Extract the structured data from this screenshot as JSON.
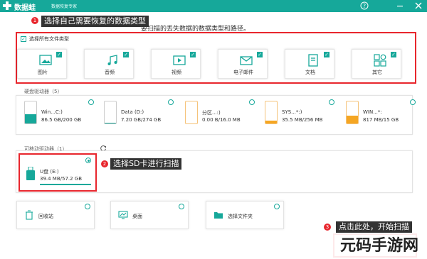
{
  "app": {
    "title": "数据蛙",
    "subtitle": "数据恢复专家",
    "window_controls": {
      "help": "?",
      "minimize": "—",
      "close": "✕"
    }
  },
  "steps": {
    "step1": {
      "num": "1",
      "text": "选择自己需要恢复的数据类型"
    },
    "step2": {
      "num": "2",
      "text": "选择SD卡进行扫描"
    },
    "step3": {
      "num": "3",
      "text": "点击此处，开始扫描"
    }
  },
  "hint": "要扫描的丢失数据的数据类型和路径。",
  "file_types": {
    "select_all_label": "选择所有文件类型",
    "select_all_checked": true,
    "items": [
      {
        "label": "图片",
        "icon": "image-icon",
        "checked": true
      },
      {
        "label": "音频",
        "icon": "audio-icon",
        "checked": true
      },
      {
        "label": "视频",
        "icon": "video-icon",
        "checked": true
      },
      {
        "label": "电子邮件",
        "icon": "email-icon",
        "checked": true
      },
      {
        "label": "文档",
        "icon": "document-icon",
        "checked": true
      },
      {
        "label": "其它",
        "icon": "other-icon",
        "checked": true
      }
    ]
  },
  "hard_drives": {
    "title": "硬盘驱动器（5）",
    "items": [
      {
        "name": "Win...C:)",
        "size": "86.5 GB/200 GB",
        "used": 0.43,
        "color": "#16a89a"
      },
      {
        "name": "Data (D:)",
        "size": "7.20 GB/274 GB",
        "used": 0.03,
        "color": "#16a89a"
      },
      {
        "name": "分区...:)",
        "size": "0.00 B/16.0 MB",
        "used": 0.0,
        "color": "#f5a623"
      },
      {
        "name": "SYS...*:)",
        "size": "35.5 MB/256 MB",
        "used": 0.14,
        "color": "#f5a623"
      },
      {
        "name": "WIN...*:",
        "size": "817 MB/15 GB",
        "used": 0.05,
        "color": "#f5a623"
      }
    ]
  },
  "removable": {
    "title": "可移动驱动器（1）",
    "item": {
      "name": "U盘 (E:)",
      "size": "39.4 MB/57.2 GB",
      "selected": true
    }
  },
  "locations": [
    {
      "label": "回收站",
      "icon": "recycle-bin-icon"
    },
    {
      "label": "桌面",
      "icon": "desktop-icon"
    },
    {
      "label": "选择文件夹",
      "icon": "folder-icon"
    }
  ],
  "watermark": "元码手游网",
  "colors": {
    "brand": "#16a89a",
    "highlight": "#e8262d",
    "callout_bg": "#333333",
    "orange": "#f5a623"
  }
}
